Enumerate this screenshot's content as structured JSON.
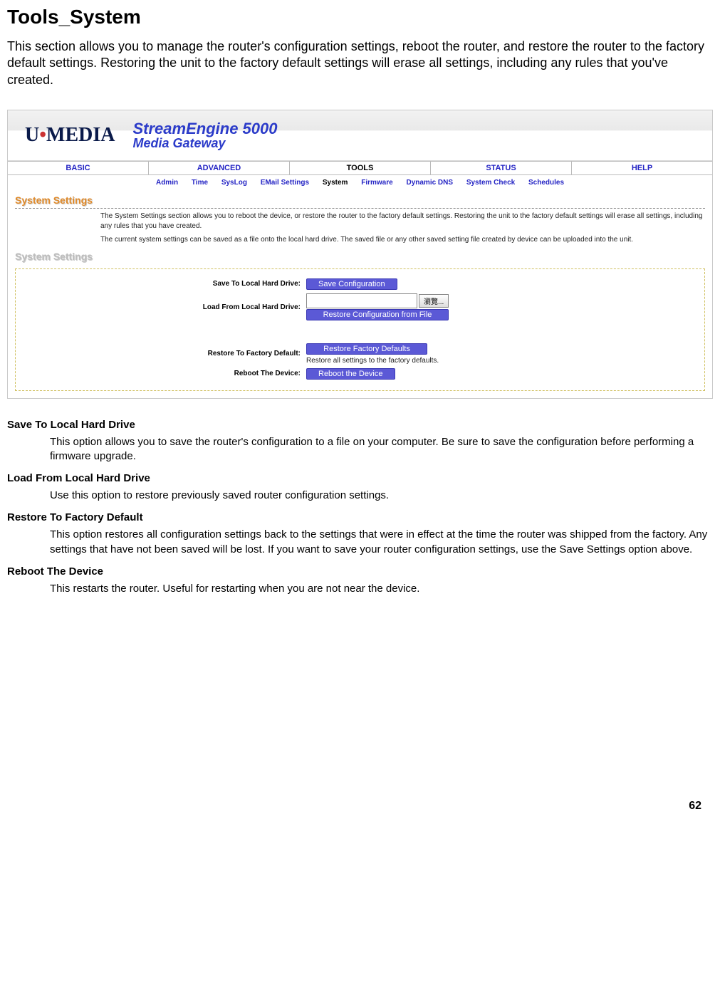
{
  "page": {
    "title": "Tools_System",
    "intro": "This section allows you to manage the router's configuration settings, reboot the router, and restore the router to the factory default settings. Restoring the unit to the factory default settings will erase all settings, including any rules that you've created.",
    "number": "62"
  },
  "branding": {
    "logo_left": "U",
    "logo_dot": "•",
    "logo_right": "MEDIA",
    "line1": "StreamEngine 5000",
    "line2": "Media Gateway"
  },
  "tabs": {
    "items": [
      "BASIC",
      "ADVANCED",
      "TOOLS",
      "STATUS",
      "HELP"
    ],
    "active": "TOOLS"
  },
  "subnav": {
    "items": [
      "Admin",
      "Time",
      "SysLog",
      "EMail Settings",
      "System",
      "Firmware",
      "Dynamic DNS",
      "System Check",
      "Schedules"
    ],
    "active": "System"
  },
  "section": {
    "heading": "System Settings",
    "blurb1": "The System Settings section allows you to reboot the device, or restore the router to the factory default settings. Restoring the unit to the factory default settings will erase all settings, including any rules that you have created.",
    "blurb2": "The current system settings can be saved as a file onto the local hard drive. The saved file or any other saved setting file created by device can be uploaded into the unit.",
    "heading2": "System Settings"
  },
  "form": {
    "row1_label": "Save To Local Hard Drive:",
    "row1_btn": "Save Configuration",
    "row2_label": "Load From Local Hard Drive:",
    "row2_browse": "瀏覽...",
    "row2_btn": "Restore Configuration from File",
    "row3_label": "Restore To Factory Default:",
    "row3_btn": "Restore Factory Defaults",
    "row3_hint": "Restore all settings to the factory defaults.",
    "row4_label": "Reboot The Device:",
    "row4_btn": "Reboot the Device"
  },
  "defs": {
    "t1": "Save To Local Hard Drive",
    "d1": "This option allows you to save the router's configuration to a file on your computer. Be sure to save the configuration before performing a firmware upgrade.",
    "t2": "Load From Local Hard Drive",
    "d2": "Use this option to restore previously saved router configuration settings.",
    "t3": "Restore To Factory Default",
    "d3": "This option restores all configuration settings back to the settings that were in effect at the time the router was shipped from the factory. Any settings that have not been saved will be lost. If you want to save your router configuration settings, use the Save Settings option above.",
    "t4": "Reboot The Device",
    "d4": "This restarts the router. Useful for restarting when you are not near the device."
  }
}
